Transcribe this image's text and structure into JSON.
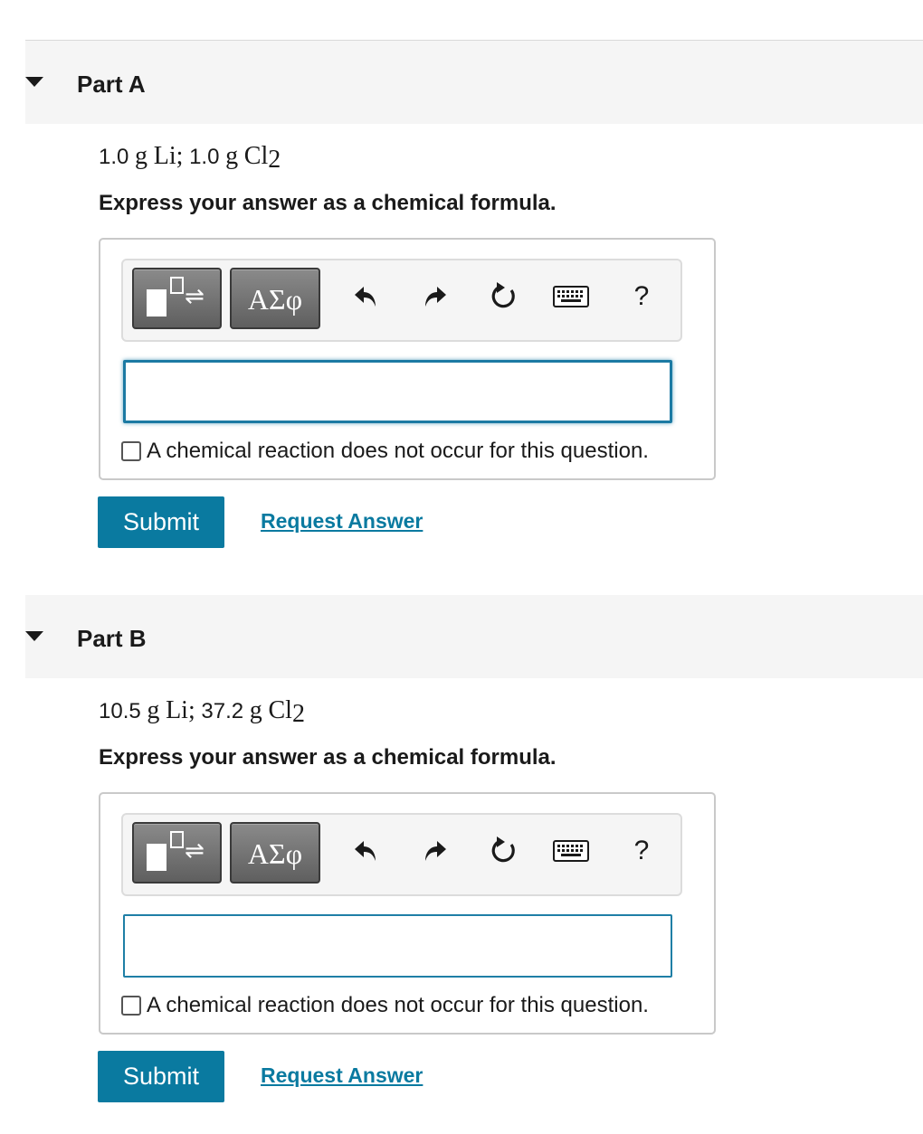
{
  "parts": [
    {
      "title": "Part A",
      "given": {
        "mass1": "1.0",
        "unit1": "g",
        "element1": "Li",
        "sep": ";",
        "mass2": "1.0",
        "unit2": "g",
        "element2": "Cl",
        "sub2": "2"
      },
      "instruction": "Express your answer as a chemical formula.",
      "toolbar": {
        "greek_label": "ΑΣφ",
        "help_label": "?"
      },
      "input_value": "",
      "checkbox_label": "A chemical reaction does not occur for this question.",
      "submit_label": "Submit",
      "request_label": "Request Answer"
    },
    {
      "title": "Part B",
      "given": {
        "mass1": "10.5",
        "unit1": "g",
        "element1": "Li",
        "sep": ";",
        "mass2": "37.2",
        "unit2": "g",
        "element2": "Cl",
        "sub2": "2"
      },
      "instruction": "Express your answer as a chemical formula.",
      "toolbar": {
        "greek_label": "ΑΣφ",
        "help_label": "?"
      },
      "input_value": "",
      "checkbox_label": "A chemical reaction does not occur for this question.",
      "submit_label": "Submit",
      "request_label": "Request Answer"
    }
  ],
  "icons": {
    "caret": "caret-down-icon",
    "templates": "templates-icon",
    "undo": "undo-icon",
    "redo": "redo-icon",
    "reset": "reset-icon",
    "keyboard": "keyboard-icon",
    "help": "help-icon"
  },
  "colors": {
    "accent": "#0a7aa0",
    "input_border": "#1f7fa6",
    "header_bg": "#f5f5f5"
  }
}
